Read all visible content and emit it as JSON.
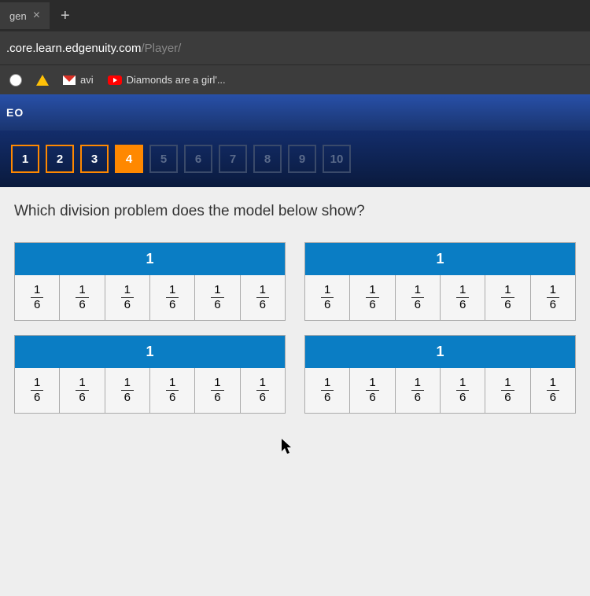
{
  "browser": {
    "tab_label": "gen",
    "url_domain": ".core.learn.edgenuity.com",
    "url_path": "/Player/",
    "bookmarks": {
      "avi": "avi",
      "diamonds": "Diamonds are a girl'..."
    }
  },
  "app": {
    "header_label": "EO"
  },
  "nav": {
    "items": [
      "1",
      "2",
      "3",
      "4",
      "5",
      "6",
      "7",
      "8",
      "9",
      "10"
    ],
    "current_index": 3,
    "enabled_count": 4
  },
  "question": "Which division problem does the model below show?",
  "model": {
    "whole_label": "1",
    "fraction_num": "1",
    "fraction_den": "6",
    "parts_per_whole": 6,
    "whole_count": 4
  }
}
